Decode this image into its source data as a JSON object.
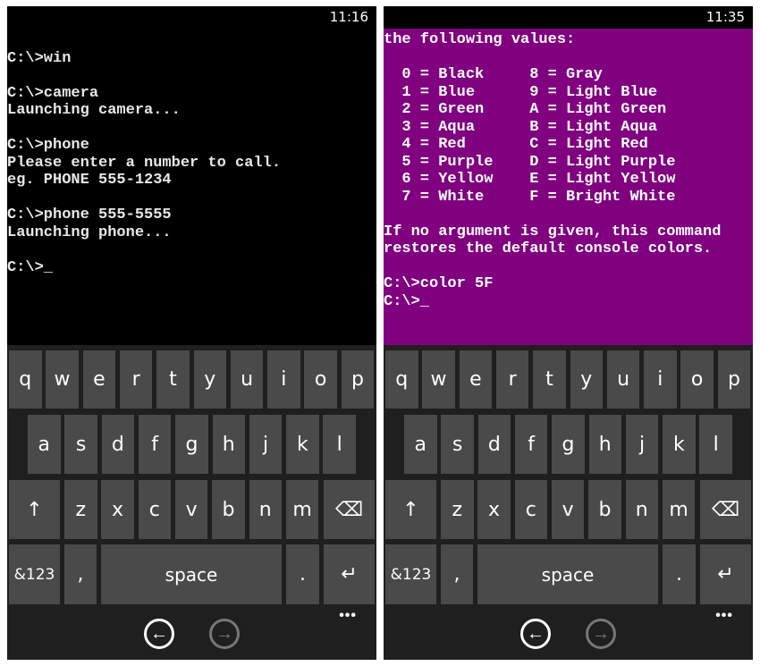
{
  "phones": [
    {
      "time": "11:16",
      "console_bg": "#000000",
      "console_fg": "#e8e8e8",
      "lines": [
        "",
        "C:\\>win",
        "",
        "C:\\>camera",
        "Launching camera...",
        "",
        "C:\\>phone",
        "Please enter a number to call.",
        "eg. PHONE 555-1234",
        "",
        "C:\\>phone 555-5555",
        "Launching phone...",
        "",
        "C:\\>_"
      ]
    },
    {
      "time": "11:35",
      "console_bg": "#800080",
      "console_fg": "#ffffff",
      "lines": [
        "the following values:",
        "",
        "  0 = Black     8 = Gray",
        "  1 = Blue      9 = Light Blue",
        "  2 = Green     A = Light Green",
        "  3 = Aqua      B = Light Aqua",
        "  4 = Red       C = Light Red",
        "  5 = Purple    D = Light Purple",
        "  6 = Yellow    E = Light Yellow",
        "  7 = White     F = Bright White",
        "",
        "If no argument is given, this command",
        "restores the default console colors.",
        "",
        "C:\\>color 5F",
        "C:\\>_"
      ]
    }
  ],
  "keyboard": {
    "row1": [
      "q",
      "w",
      "e",
      "r",
      "t",
      "y",
      "u",
      "i",
      "o",
      "p"
    ],
    "row2": [
      "a",
      "s",
      "d",
      "f",
      "g",
      "h",
      "j",
      "k",
      "l"
    ],
    "row3": [
      "↑",
      "z",
      "x",
      "c",
      "v",
      "b",
      "n",
      "m",
      "⌫"
    ],
    "row4": [
      "&123",
      ",",
      "space",
      ".",
      "↵"
    ],
    "key_color": "#4a4a4a",
    "bg_color": "#1f1f1f"
  },
  "appbar": {
    "back": "←",
    "forward": "→",
    "more": "•••"
  }
}
